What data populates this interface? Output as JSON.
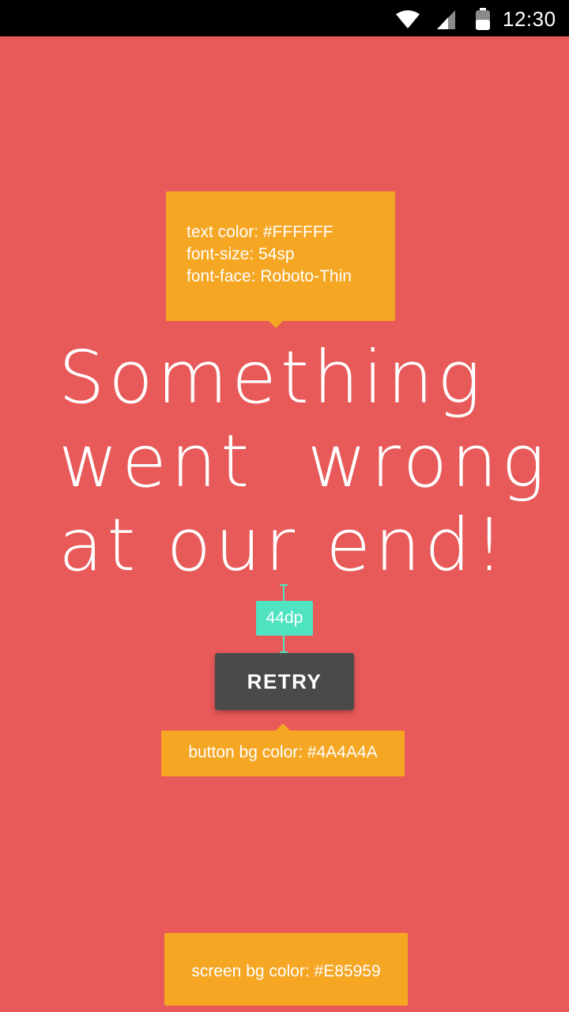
{
  "status_bar": {
    "time": "12:30",
    "icons": [
      "wifi-icon",
      "cell-signal-icon",
      "battery-icon"
    ]
  },
  "annotations": {
    "text_spec": {
      "lines": [
        "text color: #FFFFFF",
        "font-size: 54sp",
        "font-face: Roboto-Thin"
      ]
    },
    "spacing": "44dp",
    "button_spec": "button bg color: #4A4A4A",
    "screen_spec": "screen bg color: #E85959"
  },
  "main": {
    "headline_lines": [
      "Something",
      "went  wrong",
      "at our end!"
    ],
    "retry_label": "RETRY"
  },
  "colors": {
    "screen_bg": "#E85959",
    "button_bg": "#4A4A4A",
    "text": "#FFFFFF",
    "annotation_bg": "#F5A623",
    "measure": "#4FE3C1",
    "status_bar_bg": "#000000"
  }
}
